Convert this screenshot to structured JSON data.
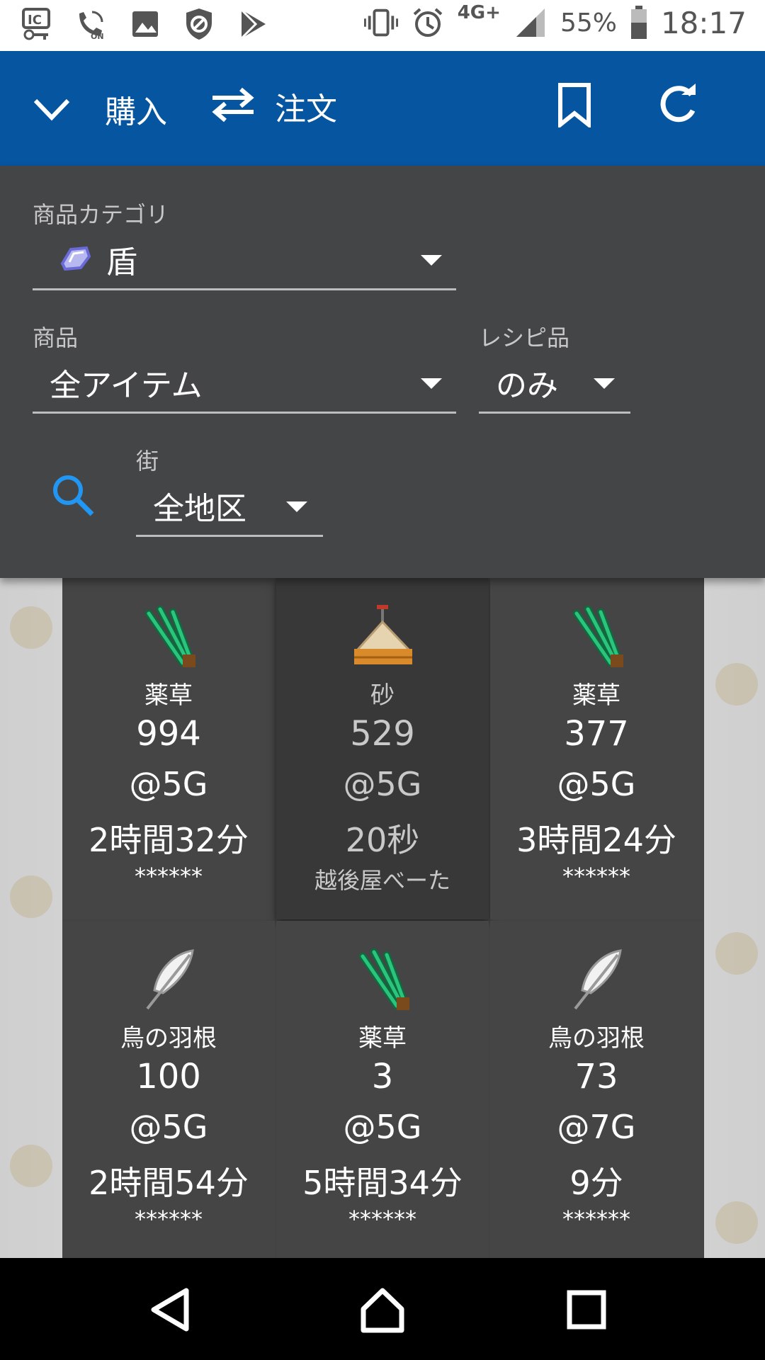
{
  "status_bar": {
    "battery_percent": "55%",
    "network": "4G+",
    "time": "18:17",
    "left_icons": [
      "ic-card-icon",
      "vpn-key-icon",
      "wifi-calling-on-icon",
      "image-icon",
      "shield-icon",
      "play-store-icon"
    ],
    "right_icons": [
      "vibrate-icon",
      "alarm-icon",
      "signal-icon",
      "battery-icon"
    ]
  },
  "app_bar": {
    "buy_label": "購入",
    "order_label": "注文",
    "color": "#0655a1"
  },
  "filters": {
    "category_label": "商品カテゴリ",
    "category_value": "盾",
    "item_label": "商品",
    "item_value": "全アイテム",
    "recipe_label": "レシピ品",
    "recipe_value": "のみ",
    "city_label": "街",
    "city_value": "全地区"
  },
  "listings": [
    {
      "name": "薬草",
      "qty": "994",
      "price": "@5G",
      "time": "2時間32分",
      "seller": "******",
      "icon": "herb-icon",
      "active": false
    },
    {
      "name": "砂",
      "qty": "529",
      "price": "@5G",
      "time": "20秒",
      "seller": "越後屋べーた",
      "icon": "sand-icon",
      "active": true
    },
    {
      "name": "薬草",
      "qty": "377",
      "price": "@5G",
      "time": "3時間24分",
      "seller": "******",
      "icon": "herb-icon",
      "active": false
    },
    {
      "name": "鳥の羽根",
      "qty": "100",
      "price": "@5G",
      "time": "2時間54分",
      "seller": "******",
      "icon": "feather-icon",
      "active": false
    },
    {
      "name": "薬草",
      "qty": "3",
      "price": "@5G",
      "time": "5時間34分",
      "seller": "******",
      "icon": "herb-icon",
      "active": false
    },
    {
      "name": "鳥の羽根",
      "qty": "73",
      "price": "@7G",
      "time": "9分",
      "seller": "******",
      "icon": "feather-icon",
      "active": false
    }
  ]
}
